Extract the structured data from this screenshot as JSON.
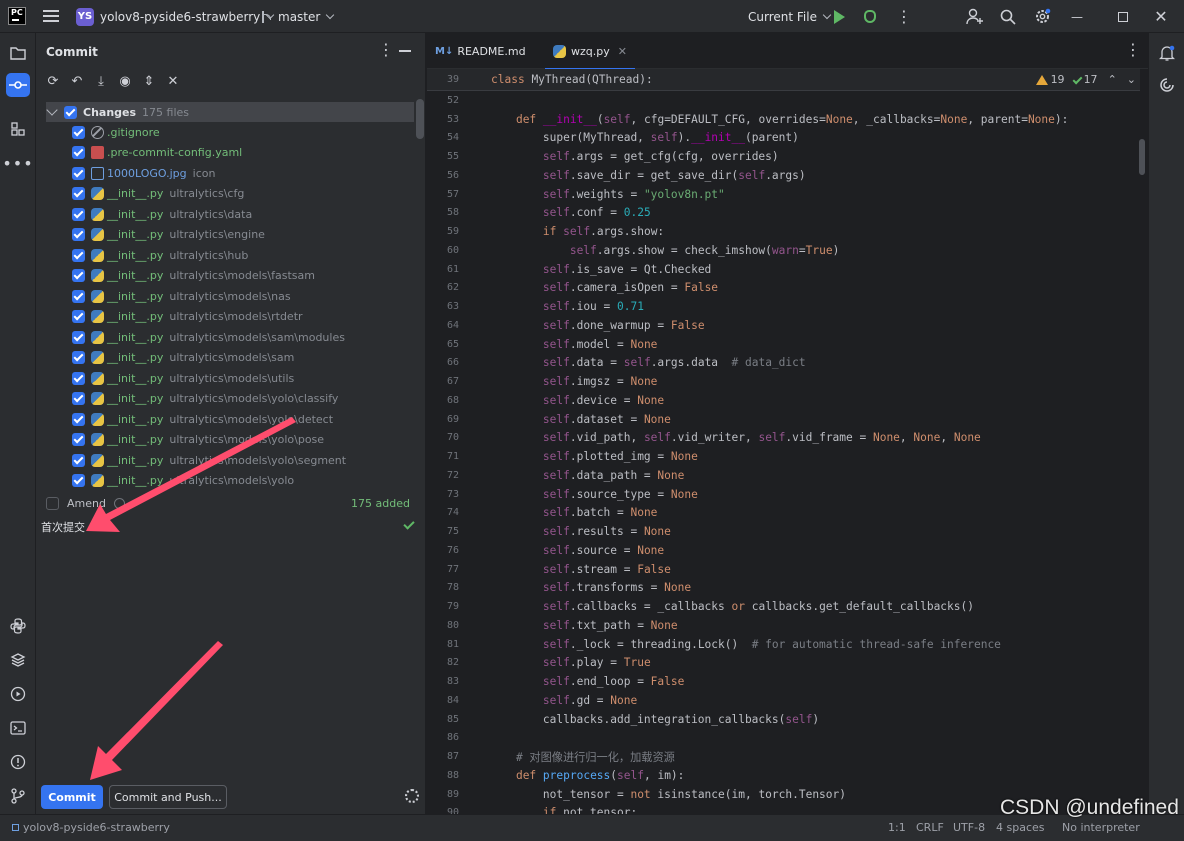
{
  "titlebar": {
    "logo": "PC",
    "project_badge": "YS",
    "project_name": "yolov8-pyside6-strawberry",
    "branch": "master",
    "run_config": "Current File"
  },
  "commit_panel": {
    "title": "Commit",
    "changes_label": "Changes",
    "changes_count": "175 files",
    "files": [
      {
        "name": ".gitignore",
        "path": "",
        "icon": "ignore-file-icon",
        "color": "green"
      },
      {
        "name": ".pre-commit-config.yaml",
        "path": "",
        "icon": "yaml-file-icon",
        "color": "green"
      },
      {
        "name": "1000LOGO.jpg",
        "path": "icon",
        "icon": "image-file-icon",
        "color": "blue"
      },
      {
        "name": "__init__.py",
        "path": "ultralytics\\cfg",
        "icon": "python-file-icon",
        "color": "green"
      },
      {
        "name": "__init__.py",
        "path": "ultralytics\\data",
        "icon": "python-file-icon",
        "color": "green"
      },
      {
        "name": "__init__.py",
        "path": "ultralytics\\engine",
        "icon": "python-file-icon",
        "color": "green"
      },
      {
        "name": "__init__.py",
        "path": "ultralytics\\hub",
        "icon": "python-file-icon",
        "color": "green"
      },
      {
        "name": "__init__.py",
        "path": "ultralytics\\models\\fastsam",
        "icon": "python-file-icon",
        "color": "green"
      },
      {
        "name": "__init__.py",
        "path": "ultralytics\\models\\nas",
        "icon": "python-file-icon",
        "color": "green"
      },
      {
        "name": "__init__.py",
        "path": "ultralytics\\models\\rtdetr",
        "icon": "python-file-icon",
        "color": "green"
      },
      {
        "name": "__init__.py",
        "path": "ultralytics\\models\\sam\\modules",
        "icon": "python-file-icon",
        "color": "green"
      },
      {
        "name": "__init__.py",
        "path": "ultralytics\\models\\sam",
        "icon": "python-file-icon",
        "color": "green"
      },
      {
        "name": "__init__.py",
        "path": "ultralytics\\models\\utils",
        "icon": "python-file-icon",
        "color": "green"
      },
      {
        "name": "__init__.py",
        "path": "ultralytics\\models\\yolo\\classify",
        "icon": "python-file-icon",
        "color": "green"
      },
      {
        "name": "__init__.py",
        "path": "ultralytics\\models\\yolo\\detect",
        "icon": "python-file-icon",
        "color": "green"
      },
      {
        "name": "__init__.py",
        "path": "ultralytics\\models\\yolo\\pose",
        "icon": "python-file-icon",
        "color": "green"
      },
      {
        "name": "__init__.py",
        "path": "ultralytics\\models\\yolo\\segment",
        "icon": "python-file-icon",
        "color": "green"
      },
      {
        "name": "__init__.py",
        "path": "ultralytics\\models\\yolo",
        "icon": "python-file-icon",
        "color": "green"
      }
    ],
    "amend_label": "Amend",
    "added_summary": "175 added",
    "commit_message": "首次提交",
    "commit_button": "Commit",
    "commit_push_button": "Commit and Push..."
  },
  "editor": {
    "tabs": [
      {
        "label": "README.md",
        "prefix": "M↓",
        "active": false
      },
      {
        "label": "wzq.py",
        "active": true
      }
    ],
    "warnings": "19",
    "weak_warnings": "17",
    "sticky": {
      "ln": "39",
      "text": "class MyThread(QThread):"
    },
    "lines": [
      {
        "ln": "52",
        "html": ""
      },
      {
        "ln": "53",
        "html": "    <span class='kw'>def</span> <span class='dunder'>__init__</span>(<span class='slf'>self</span>, cfg=DEFAULT_CFG, overrides=<span class='kw'>None</span>, _callbacks=<span class='kw'>None</span>, parent=<span class='kw'>None</span>):"
      },
      {
        "ln": "54",
        "html": "        super(MyThread, <span class='slf'>self</span>).<span class='dunder'>__init__</span>(parent)"
      },
      {
        "ln": "55",
        "html": "        <span class='slf'>self</span>.args = get_cfg(cfg, overrides)"
      },
      {
        "ln": "56",
        "html": "        <span class='slf'>self</span>.save_dir = get_save_dir(<span class='slf'>self</span>.args)"
      },
      {
        "ln": "57",
        "html": "        <span class='slf'>self</span>.weights = <span class='str'>\"yolov8n.pt\"</span>"
      },
      {
        "ln": "58",
        "html": "        <span class='slf'>self</span>.conf = <span class='num'>0.25</span>"
      },
      {
        "ln": "59",
        "html": "        <span class='kw'>if</span> <span class='slf'>self</span>.args.show:"
      },
      {
        "ln": "60",
        "html": "            <span class='slf'>self</span>.args.show = check_imshow(<span class='inlay'>warn</span>=<span class='kw'>True</span>)"
      },
      {
        "ln": "61",
        "html": "        <span class='slf'>self</span>.is_save = Qt.Checked"
      },
      {
        "ln": "62",
        "html": "        <span class='slf'>self</span>.camera_isOpen = <span class='kw'>False</span>"
      },
      {
        "ln": "63",
        "html": "        <span class='slf'>self</span>.iou = <span class='num'>0.71</span>"
      },
      {
        "ln": "64",
        "html": "        <span class='slf'>self</span>.done_warmup = <span class='kw'>False</span>"
      },
      {
        "ln": "65",
        "html": "        <span class='slf'>self</span>.model = <span class='kw'>None</span>"
      },
      {
        "ln": "66",
        "html": "        <span class='slf'>self</span>.data = <span class='slf'>self</span>.args.data  <span class='cmt'># data_dict</span>"
      },
      {
        "ln": "67",
        "html": "        <span class='slf'>self</span>.imgsz = <span class='kw'>None</span>"
      },
      {
        "ln": "68",
        "html": "        <span class='slf'>self</span>.device = <span class='kw'>None</span>"
      },
      {
        "ln": "69",
        "html": "        <span class='slf'>self</span>.dataset = <span class='kw'>None</span>"
      },
      {
        "ln": "70",
        "html": "        <span class='slf'>self</span>.vid_path, <span class='slf'>self</span>.vid_writer, <span class='slf'>self</span>.vid_frame = <span class='kw'>None</span>, <span class='kw'>None</span>, <span class='kw'>None</span>"
      },
      {
        "ln": "71",
        "html": "        <span class='slf'>self</span>.plotted_img = <span class='kw'>None</span>"
      },
      {
        "ln": "72",
        "html": "        <span class='slf'>self</span>.data_path = <span class='kw'>None</span>"
      },
      {
        "ln": "73",
        "html": "        <span class='slf'>self</span>.source_type = <span class='kw'>None</span>"
      },
      {
        "ln": "74",
        "html": "        <span class='slf'>self</span>.batch = <span class='kw'>None</span>"
      },
      {
        "ln": "75",
        "html": "        <span class='slf'>self</span>.results = <span class='kw'>None</span>"
      },
      {
        "ln": "76",
        "html": "        <span class='slf'>self</span>.source = <span class='kw'>None</span>"
      },
      {
        "ln": "77",
        "html": "        <span class='slf'>self</span>.stream = <span class='kw'>False</span>"
      },
      {
        "ln": "78",
        "html": "        <span class='slf'>self</span>.transforms = <span class='kw'>None</span>"
      },
      {
        "ln": "79",
        "html": "        <span class='slf'>self</span>.callbacks = _callbacks <span class='kw'>or</span> callbacks.get_default_callbacks()"
      },
      {
        "ln": "80",
        "html": "        <span class='slf'>self</span>.txt_path = <span class='kw'>None</span>"
      },
      {
        "ln": "81",
        "html": "        <span class='slf'>self</span>._lock = threading.Lock()  <span class='cmt'># for automatic thread-safe inference</span>"
      },
      {
        "ln": "82",
        "html": "        <span class='slf'>self</span>.play = <span class='kw'>True</span>"
      },
      {
        "ln": "83",
        "html": "        <span class='slf'>self</span>.end_loop = <span class='kw'>False</span>"
      },
      {
        "ln": "84",
        "html": "        <span class='slf'>self</span>.gd = <span class='kw'>None</span>"
      },
      {
        "ln": "85",
        "html": "        callbacks.add_integration_callbacks(<span class='slf'>self</span>)"
      },
      {
        "ln": "86",
        "html": ""
      },
      {
        "ln": "87",
        "html": "    <span class='cmt'># 对图像进行归一化，加载资源</span>"
      },
      {
        "ln": "88",
        "html": "    <span class='kw'>def</span> <span class='fn'>preprocess</span>(<span class='slf'>self</span>, im):"
      },
      {
        "ln": "89",
        "html": "        not_tensor = <span class='kw'>not</span> isinstance(im, torch.Tensor)"
      },
      {
        "ln": "90",
        "html": "        <span class='kw'>if</span> not_tensor:"
      }
    ]
  },
  "statusbar": {
    "project": "yolov8-pyside6-strawberry",
    "position": "1:1",
    "line_sep": "CRLF",
    "encoding": "UTF-8",
    "indent": "4 spaces",
    "interpreter": "No interpreter"
  },
  "watermark": "CSDN @undefined",
  "colors": {
    "accent": "#3574f0",
    "added_green": "#73bd79",
    "arrow_red": "#ff4d6d"
  }
}
